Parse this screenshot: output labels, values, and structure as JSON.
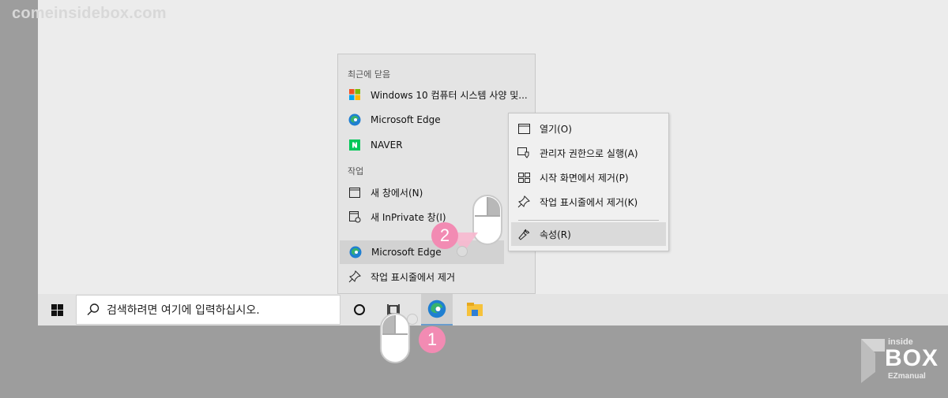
{
  "watermark": "comeinsidebox.com",
  "taskbar": {
    "search_placeholder": "검색하려면 여기에 입력하십시오."
  },
  "jumplist": {
    "recent_header": "최근에 닫음",
    "recent_items": [
      {
        "label": "Windows 10 컴퓨터 시스템 사양 및..."
      },
      {
        "label": "Microsoft Edge"
      },
      {
        "label": "NAVER"
      }
    ],
    "tasks_header": "작업",
    "task_items": [
      {
        "label": "새 창에서(N)"
      },
      {
        "label": "새 InPrivate 창(I)"
      }
    ],
    "app_item": "Microsoft Edge",
    "unpin_item": "작업 표시줄에서 제거"
  },
  "context_menu": {
    "items": [
      {
        "label": "열기(O)"
      },
      {
        "label": "관리자 권한으로 실행(A)"
      },
      {
        "label": "시작 화면에서 제거(P)"
      },
      {
        "label": "작업 표시줄에서 제거(K)"
      },
      {
        "label": "속성(R)"
      }
    ]
  },
  "annotations": {
    "step1": "1",
    "step2": "2"
  },
  "brand_logo": {
    "top": "inside",
    "middle": "BOX",
    "bottom": "EZmanual"
  },
  "colors": {
    "badge": "#f28bb3",
    "edge_blue": "#1f7fd1",
    "edge_green": "#38b36b",
    "naver_green": "#03c75a"
  }
}
